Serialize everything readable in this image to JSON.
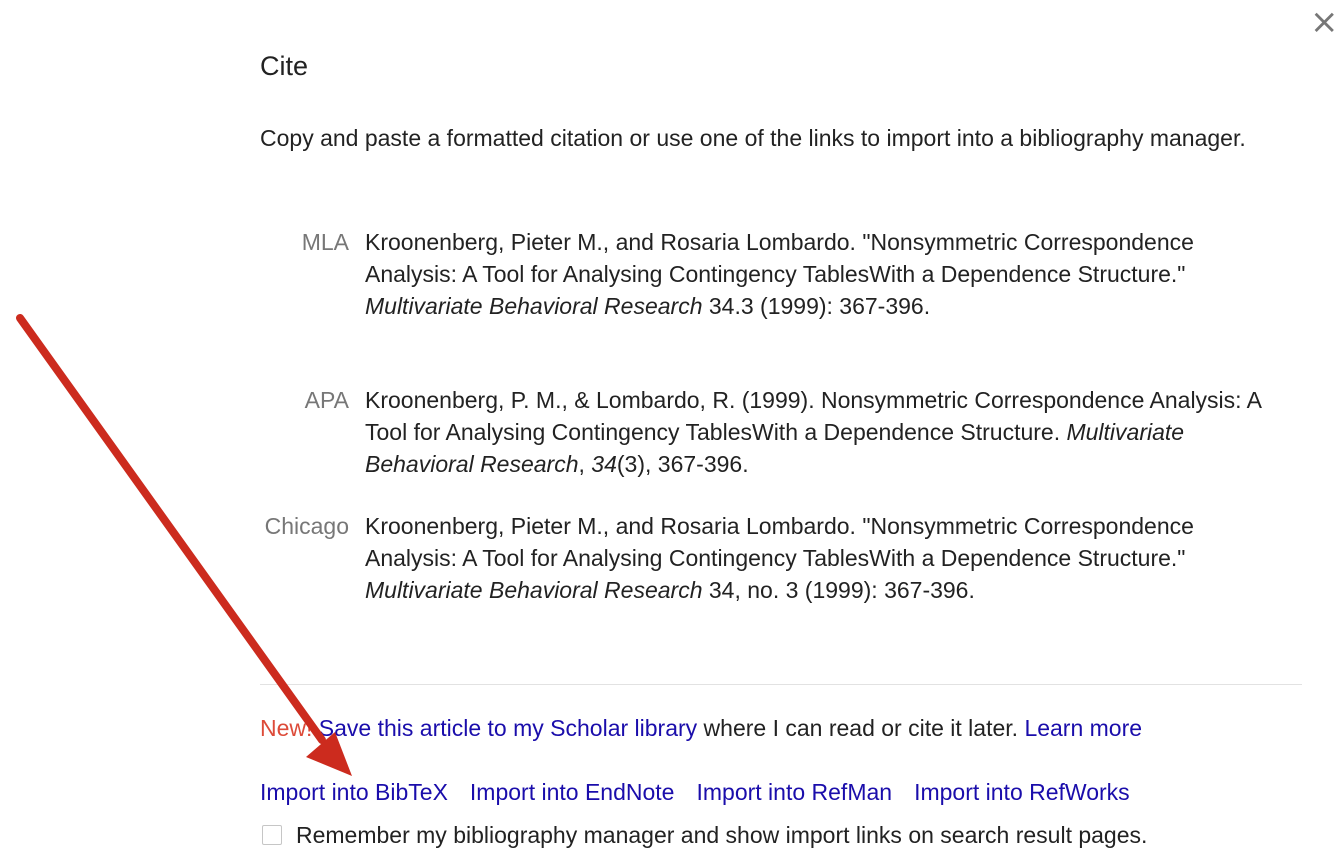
{
  "dialog": {
    "title": "Cite",
    "close_glyph": "×",
    "intro": "Copy and paste a formatted citation or use one of the links to import into a bibliography manager."
  },
  "citations": [
    {
      "label": "MLA",
      "before": "Kroonenberg, Pieter M., and Rosaria Lombardo. \"Nonsymmetric Correspondence Analysis: A Tool for Analysing Contingency TablesWith a Dependence Structure.\" ",
      "journal": "Multivariate Behavioral Research",
      "after": " 34.3 (1999): 367-396."
    },
    {
      "label": "APA",
      "before": "Kroonenberg, P. M., & Lombardo, R. (1999). Nonsymmetric Correspondence Analysis: A Tool for Analysing Contingency TablesWith a Dependence Structure. ",
      "journal": "Multivariate Behavioral Research",
      "mid": ", ",
      "volume": "34",
      "after": "(3), 367-396."
    },
    {
      "label": "Chicago",
      "before": "Kroonenberg, Pieter M., and Rosaria Lombardo. \"Nonsymmetric Correspondence Analysis: A Tool for Analysing Contingency TablesWith a Dependence Structure.\" ",
      "journal": "Multivariate Behavioral Research",
      "after": " 34, no. 3 (1999): 367-396."
    }
  ],
  "scholar": {
    "new_badge": "New!",
    "save_link": "Save this article to my Scholar library",
    "middle_text": " where I can read or cite it later. ",
    "learn_more": "Learn more"
  },
  "imports": [
    "Import into BibTeX",
    "Import into EndNote",
    "Import into RefMan",
    "Import into RefWorks"
  ],
  "remember": {
    "label": "Remember my bibliography manager and show import links on search result pages.",
    "checked": false
  },
  "colors": {
    "link": "#1a0dab",
    "new_badge": "#dd4b39",
    "arrow": "#cc2b1e"
  },
  "annotation": {
    "type": "arrow",
    "points_to": "Import into BibTeX"
  }
}
